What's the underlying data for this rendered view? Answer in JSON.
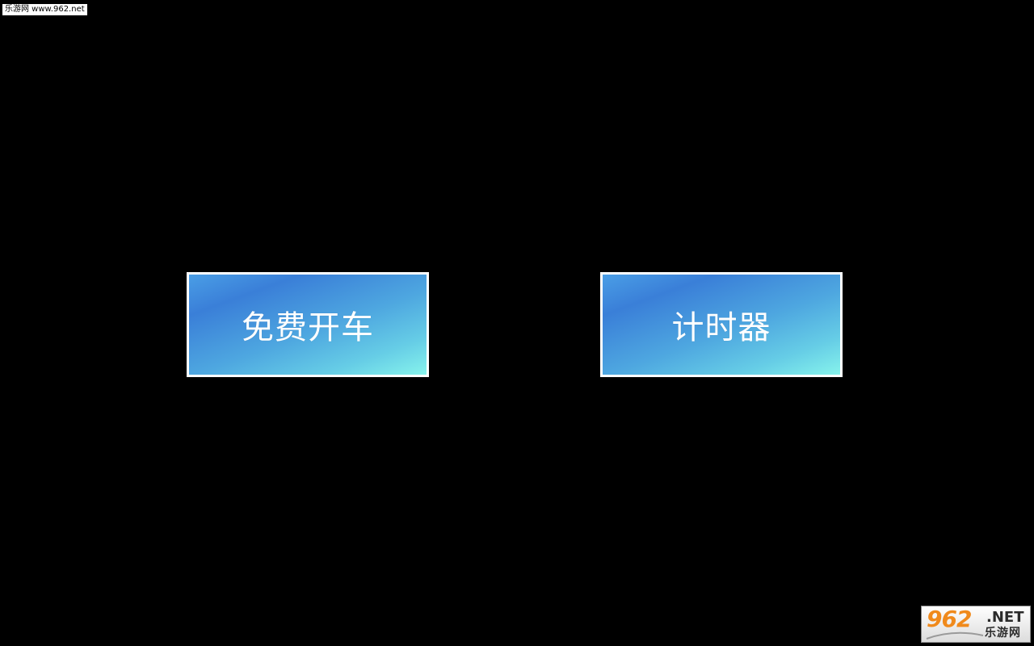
{
  "watermark": {
    "text": "乐游网 www.962.net"
  },
  "menu": {
    "buttons": [
      {
        "label": "免费开车"
      },
      {
        "label": "计时器"
      }
    ]
  },
  "logo": {
    "number": "962",
    "suffix": ".NET",
    "chinese": "乐游网"
  },
  "colors": {
    "background": "#000000",
    "button_gradient_start": "#3a7fd8",
    "button_gradient_end": "#86f3ec",
    "button_border": "#ffffff",
    "logo_accent": "#f08a1c"
  }
}
